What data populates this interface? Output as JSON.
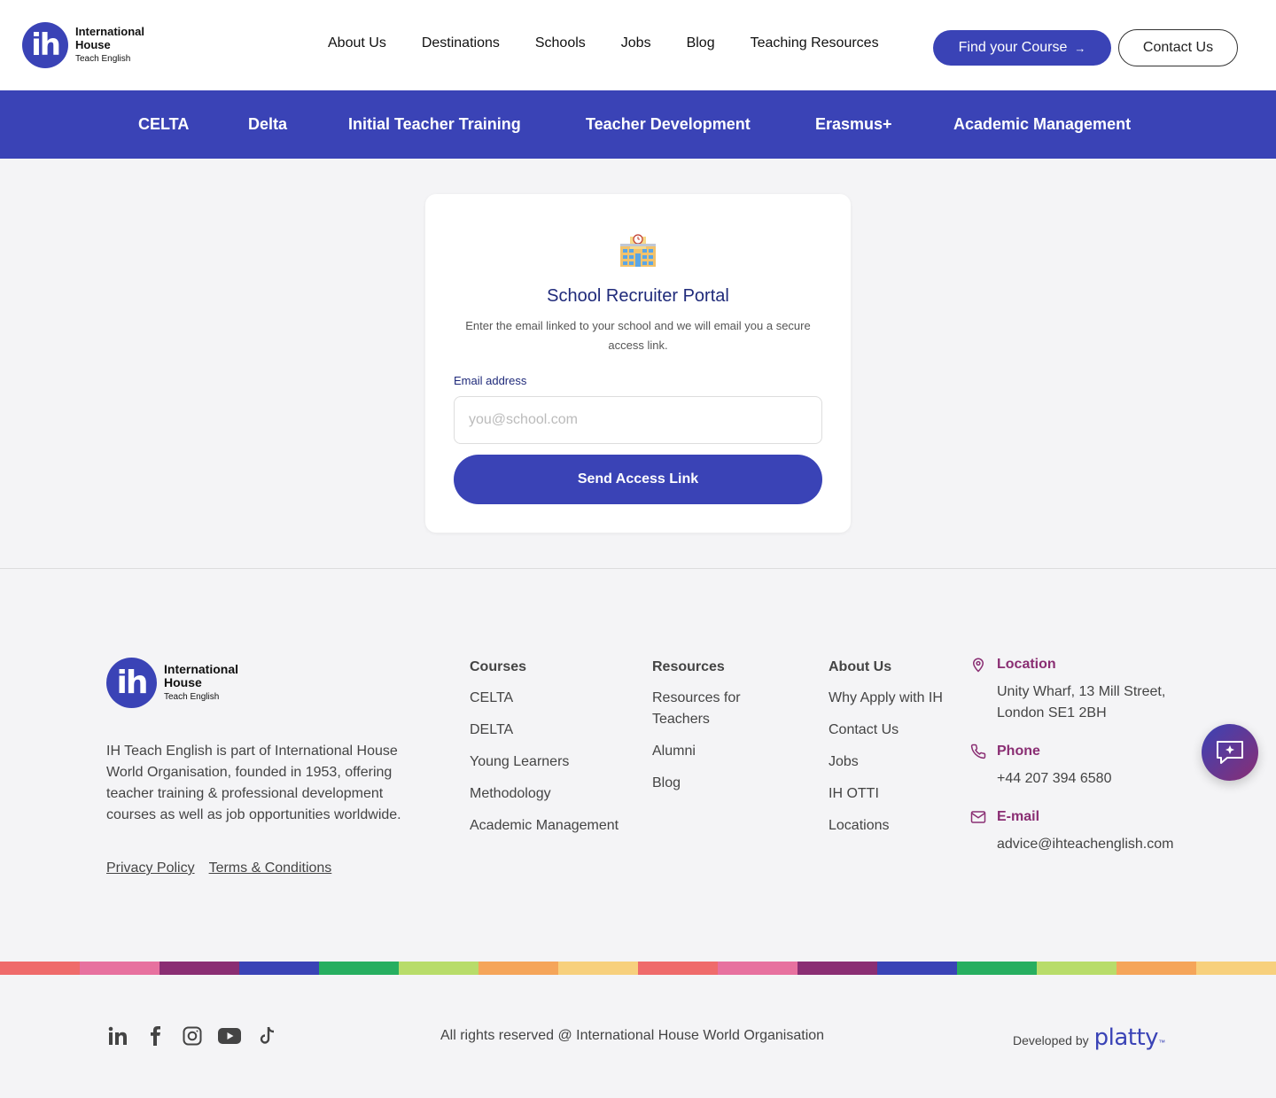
{
  "logo": {
    "mark": "ih",
    "line1": "International",
    "line2": "House",
    "line3": "Teach English"
  },
  "header": {
    "nav": [
      "About Us",
      "Destinations",
      "Schools",
      "Jobs",
      "Blog",
      "Teaching Resources"
    ],
    "find_course": "Find your Course",
    "find_course_arrow": "→",
    "contact": "Contact Us"
  },
  "subnav": [
    "CELTA",
    "Delta",
    "Initial Teacher Training",
    "Teacher Development",
    "Erasmus+",
    "Academic Management"
  ],
  "portal": {
    "icon": "school-building-icon",
    "title": "School Recruiter Portal",
    "description": "Enter the email linked to your school and we will email you a secure access link.",
    "email_label": "Email address",
    "email_placeholder": "you@school.com",
    "email_value": "",
    "submit": "Send Access Link"
  },
  "footer": {
    "about": "IH Teach English is part of International House World Organisation, founded in 1953, offering teacher training & professional development courses as well as job opportunities worldwide.",
    "privacy": "Privacy Policy",
    "terms": "Terms & Conditions",
    "courses": {
      "heading": "Courses",
      "items": [
        "CELTA",
        "DELTA",
        "Young Learners",
        "Methodology",
        "Academic Management"
      ]
    },
    "resources": {
      "heading": "Resources",
      "items": [
        "Resources for Teachers",
        "Alumni",
        "Blog"
      ]
    },
    "about_us": {
      "heading": "About Us",
      "items": [
        "Why Apply with IH",
        "Contact Us",
        "Jobs",
        "IH OTTI",
        "Locations"
      ]
    },
    "location": {
      "heading": "Location",
      "value": "Unity Wharf, 13 Mill Street, London SE1 2BH"
    },
    "phone": {
      "heading": "Phone",
      "value": "+44 207 394 6580"
    },
    "email": {
      "heading": "E-mail",
      "value": "advice@ihteachenglish.com"
    },
    "copyright": "All rights reserved @ International House World Organisation",
    "developed_by": "Developed by",
    "developer": "platty",
    "developer_tm": "™",
    "socials": [
      "linkedin-icon",
      "facebook-icon",
      "instagram-icon",
      "youtube-icon",
      "tiktok-icon"
    ]
  },
  "colors": {
    "brand": "#3a43b6",
    "accent": "#8a2e73",
    "stripe": [
      "#ef6b6b",
      "#e7719f",
      "#8a2e73",
      "#3a43b6",
      "#27ae60",
      "#b8dc6a",
      "#f5a55a",
      "#f7d07d",
      "#ef6b6b",
      "#e7719f",
      "#8a2e73",
      "#3a43b6",
      "#27ae60",
      "#b8dc6a",
      "#f5a55a",
      "#f7d07d"
    ]
  }
}
